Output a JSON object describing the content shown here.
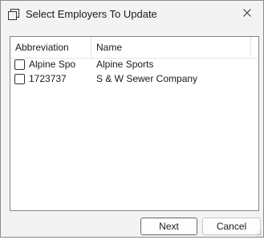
{
  "window": {
    "title": "Select Employers To Update",
    "icon": "window-restore-icon",
    "close_icon": "close-icon"
  },
  "list": {
    "columns": [
      "Abbreviation",
      "Name"
    ],
    "rows": [
      {
        "abbreviation": "Alpine Spo",
        "name": "Alpine Sports",
        "checked": false
      },
      {
        "abbreviation": "1723737",
        "name": "S & W Sewer Company",
        "checked": false
      }
    ]
  },
  "buttons": {
    "next": "Next",
    "cancel": "Cancel"
  }
}
